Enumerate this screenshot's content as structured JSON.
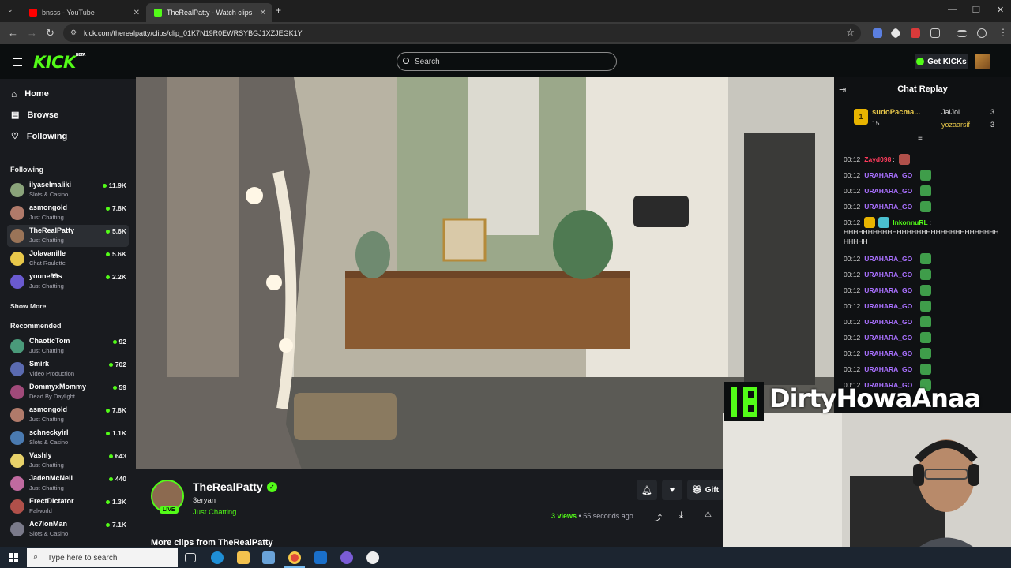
{
  "browser": {
    "tabs": [
      {
        "title": "bnsss - YouTube"
      },
      {
        "title": "TheRealPatty - Watch clips"
      }
    ],
    "url": "kick.com/therealpatty/clips/clip_01K7N19R0EWRSYBGJ1XZJEGK1Y"
  },
  "header": {
    "logo": "KICK",
    "logo_badge": "BETA",
    "search_placeholder": "Search",
    "get_kicks": "Get KICKs"
  },
  "sidebar": {
    "nav": [
      {
        "label": "Home",
        "icon": "home-icon"
      },
      {
        "label": "Browse",
        "icon": "browse-icon"
      },
      {
        "label": "Following",
        "icon": "heart-icon"
      }
    ],
    "following_title": "Following",
    "following": [
      {
        "name": "ilyaselmaliki",
        "category": "Slots & Casino",
        "viewers": "11.9K"
      },
      {
        "name": "asmongold",
        "category": "Just Chatting",
        "viewers": "7.8K"
      },
      {
        "name": "TheRealPatty",
        "category": "Just Chatting",
        "viewers": "5.6K"
      },
      {
        "name": "Jolavanille",
        "category": "Chat Roulette",
        "viewers": "5.6K"
      },
      {
        "name": "youne99s",
        "category": "Just Chatting",
        "viewers": "2.2K"
      }
    ],
    "show_more": "Show More",
    "recommended_title": "Recommended",
    "recommended": [
      {
        "name": "ChaoticTom",
        "category": "Just Chatting",
        "viewers": "92"
      },
      {
        "name": "Smirk",
        "category": "Video Production",
        "viewers": "702"
      },
      {
        "name": "DommyxMommy",
        "category": "Dead By Daylight",
        "viewers": "59"
      },
      {
        "name": "asmongold",
        "category": "Just Chatting",
        "viewers": "7.8K"
      },
      {
        "name": "schneckyirl",
        "category": "Slots & Casino",
        "viewers": "1.1K"
      },
      {
        "name": "Vashly",
        "category": "Just Chatting",
        "viewers": "643"
      },
      {
        "name": "JadenMcNeil",
        "category": "Just Chatting",
        "viewers": "440"
      },
      {
        "name": "ErectDictator",
        "category": "Palworld",
        "viewers": "1.3K"
      },
      {
        "name": "Ac7ionMan",
        "category": "Slots & Casino",
        "viewers": "7.1K"
      }
    ]
  },
  "clip": {
    "channel": "TheRealPatty",
    "title": "3eryan",
    "category": "Just Chatting",
    "live_badge": "LIVE",
    "views": "3 views",
    "time_ago": "55 seconds ago",
    "gift_label": "Gift",
    "more_clips": "More clips from TheRealPatty"
  },
  "chat": {
    "title": "Chat Replay",
    "leaders": [
      {
        "rank": "1",
        "name": "sudoPacma...",
        "count": "15"
      },
      {
        "name": "JalJol",
        "count": "3"
      },
      {
        "name": "yozaarsif",
        "count": "3"
      }
    ],
    "messages": [
      {
        "time": "00:12",
        "user": "Zayd098",
        "color": "#ff3b5c",
        "text": ":"
      },
      {
        "time": "00:12",
        "user": "URAHARA_GO",
        "color": "#a970ff",
        "text": ":"
      },
      {
        "time": "00:12",
        "user": "URAHARA_GO",
        "color": "#a970ff",
        "text": ":"
      },
      {
        "time": "00:12",
        "user": "URAHARA_GO",
        "color": "#a970ff",
        "text": ":"
      },
      {
        "time": "00:12",
        "user": "InkonnuRL",
        "color": "#53fc18",
        "text": ":"
      },
      {
        "time": "00:12",
        "user": "URAHARA_GO",
        "color": "#a970ff",
        "text": ":"
      },
      {
        "time": "00:12",
        "user": "URAHARA_GO",
        "color": "#a970ff",
        "text": ":"
      },
      {
        "time": "00:12",
        "user": "URAHARA_GO",
        "color": "#a970ff",
        "text": ":"
      },
      {
        "time": "00:12",
        "user": "URAHARA_GO",
        "color": "#a970ff",
        "text": ":"
      },
      {
        "time": "00:12",
        "user": "URAHARA_GO",
        "color": "#a970ff",
        "text": ":"
      },
      {
        "time": "00:12",
        "user": "URAHARA_GO",
        "color": "#a970ff",
        "text": ":"
      },
      {
        "time": "00:12",
        "user": "URAHARA_GO",
        "color": "#a970ff",
        "text": ":"
      },
      {
        "time": "00:12",
        "user": "URAHARA_GO",
        "color": "#a970ff",
        "text": ":"
      },
      {
        "time": "00:12",
        "user": "URAHARA_GO",
        "color": "#a970ff",
        "text": ":"
      }
    ],
    "long_message": "HHHHHHHHHHHHHHHHHHHHHHHHHHHHHHHHHHHHH"
  },
  "overlay": {
    "name": "DirtyHowaAnaa"
  },
  "taskbar": {
    "search_placeholder": "Type here to search"
  },
  "colors": {
    "accent": "#53fc18",
    "background": "#191b1f",
    "chat_bg": "#0f1113"
  }
}
